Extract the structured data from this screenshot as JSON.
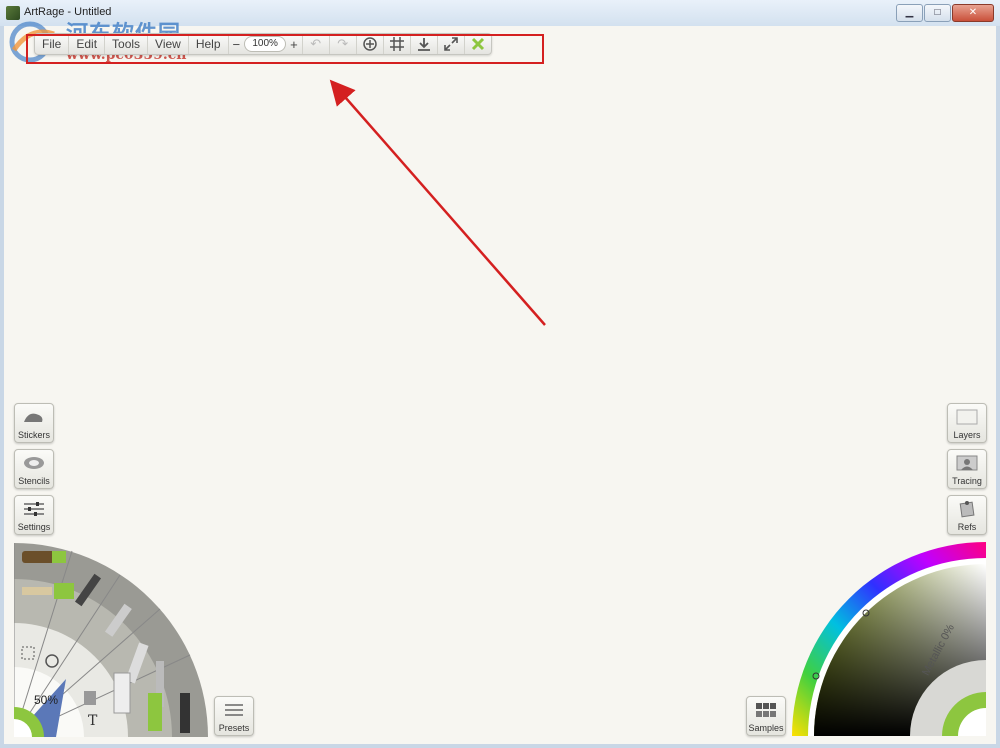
{
  "window": {
    "title": "ArtRage - Untitled",
    "buttons": [
      "minimize",
      "maximize",
      "close"
    ]
  },
  "watermark": {
    "chinese_text": "河东软件园",
    "url": "www.pc0359.cn"
  },
  "toolbar": {
    "menus": [
      "File",
      "Edit",
      "Tools",
      "View",
      "Help"
    ],
    "zoom_minus": "−",
    "zoom_value": "100%",
    "zoom_plus": "+",
    "icons": [
      "undo-icon",
      "redo-icon",
      "transform-icon",
      "grid-icon",
      "download-icon",
      "fullscreen-icon",
      "close-toolbar-icon"
    ]
  },
  "left_panel": {
    "stickers": "Stickers",
    "stencils": "Stencils",
    "settings": "Settings"
  },
  "right_panel": {
    "layers": "Layers",
    "tracing": "Tracing",
    "refs": "Refs"
  },
  "tool_wheel": {
    "zoom": "50%",
    "presets": "Presets"
  },
  "color_picker": {
    "samples": "Samples",
    "metallic": "Metallic 0%"
  },
  "colors": {
    "accent_green": "#8dc63f",
    "highlight_red": "#d42020",
    "canvas": "#f7f6f1"
  }
}
